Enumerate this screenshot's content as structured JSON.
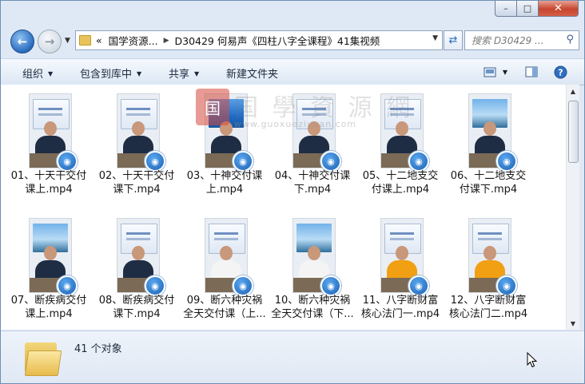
{
  "window": {
    "min_glyph": "–",
    "max_glyph": "□",
    "close_glyph": "✕"
  },
  "nav": {
    "breadcrumb": {
      "overflow": "«",
      "parent": "国学资源...",
      "current": "D30429 何易声《四柱八字全课程》41集视频"
    },
    "search_placeholder": "搜索 D30429 ..."
  },
  "toolbar": {
    "organize": "组织",
    "include_in_library": "包含到库中",
    "share": "共享",
    "new_folder": "新建文件夹"
  },
  "files": [
    {
      "line1": "01、十天干交付",
      "line2": "课上.mp4",
      "screen": "white",
      "person": "dark"
    },
    {
      "line1": "02、十天干交付",
      "line2": "课下.mp4",
      "screen": "white",
      "person": "dark"
    },
    {
      "line1": "03、十神交付课",
      "line2": "上.mp4",
      "screen": "blue",
      "person": "dark"
    },
    {
      "line1": "04、十神交付课",
      "line2": "下.mp4",
      "screen": "white",
      "person": "dark"
    },
    {
      "line1": "05、十二地支交",
      "line2": "付课上.mp4",
      "screen": "white",
      "person": "dark"
    },
    {
      "line1": "06、十二地支交",
      "line2": "付课下.mp4",
      "screen": "sky",
      "person": "dark"
    },
    {
      "line1": "07、断疾病交付",
      "line2": "课上.mp4",
      "screen": "sky",
      "person": "dark"
    },
    {
      "line1": "08、断疾病交付",
      "line2": "课下.mp4",
      "screen": "white",
      "person": "dark"
    },
    {
      "line1": "09、断六种灾祸",
      "line2": "全天交付课（上...",
      "screen": "white",
      "person": "white"
    },
    {
      "line1": "10、断六种灾祸",
      "line2": "全天交付课（下...",
      "screen": "sky",
      "person": "white"
    },
    {
      "line1": "11、八字断财富",
      "line2": "核心法门一.mp4",
      "screen": "white",
      "person": "orange"
    },
    {
      "line1": "12、八字断财富",
      "line2": "核心法门二.mp4",
      "screen": "white",
      "person": "orange"
    }
  ],
  "watermark": {
    "seal": "国",
    "title": "国 學 資 源 網",
    "url": "www.guoxueziyuan.com"
  },
  "details": {
    "count": "41 个对象"
  }
}
